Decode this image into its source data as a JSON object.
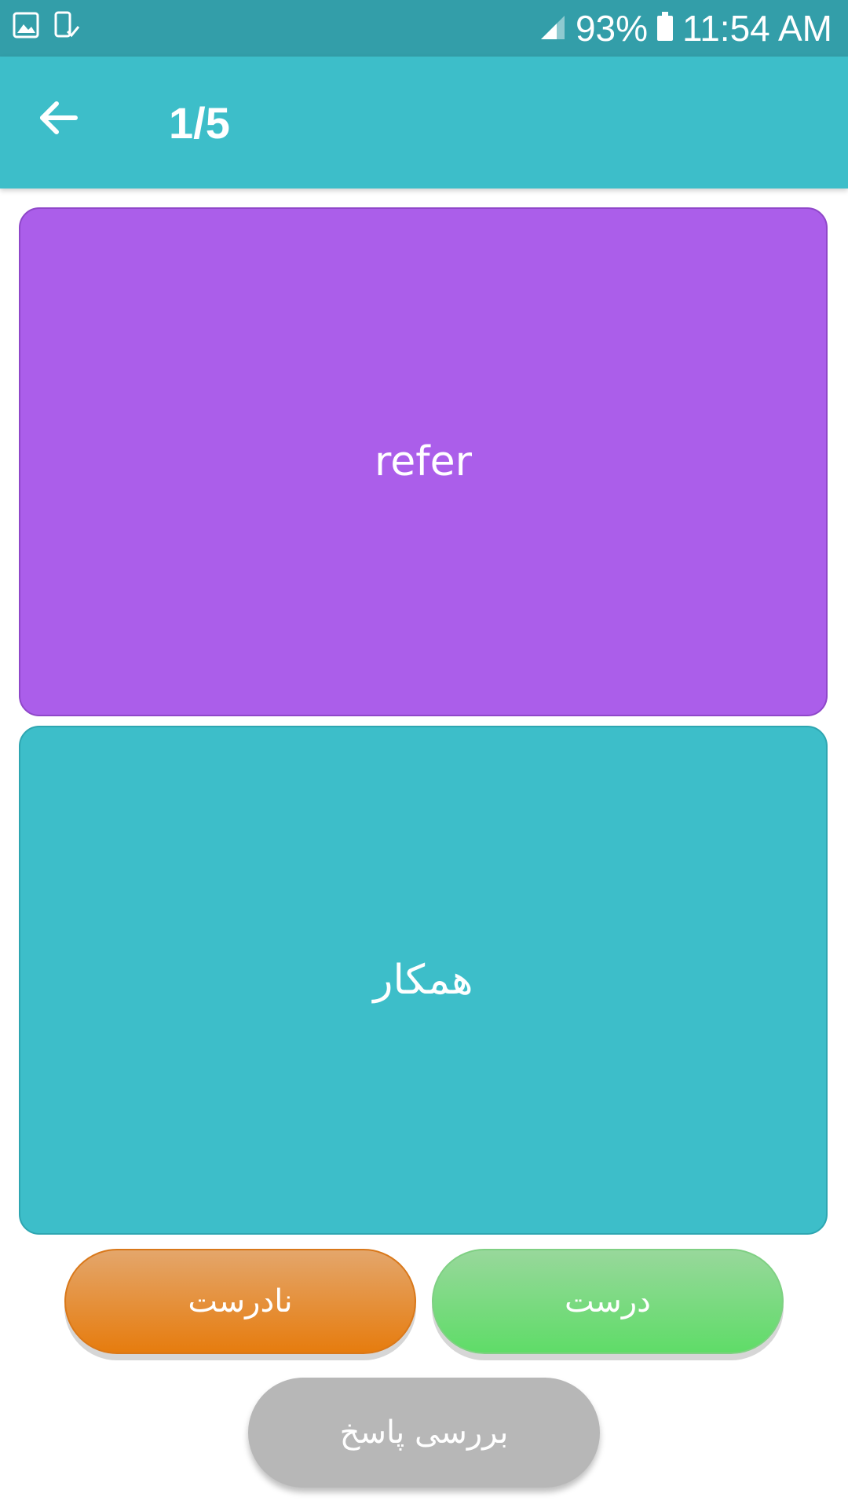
{
  "status_bar": {
    "battery": "93%",
    "time": "11:54 AM",
    "icons": [
      "gallery-icon",
      "device-check-icon",
      "signal-icon",
      "battery-icon"
    ]
  },
  "app_bar": {
    "title": "1/5",
    "back_icon": "arrow-left-icon"
  },
  "cards": {
    "word": "refer",
    "meaning": "همکار"
  },
  "buttons": {
    "wrong_label": "نادرست",
    "correct_label": "درست",
    "check_label": "بررسی پاسخ"
  },
  "colors": {
    "status_bar": "#339ea9",
    "app_bar": "#3dbec9",
    "word_card": "#ab5eea",
    "meaning_card": "#3dbec9",
    "wrong_button": "#e67c0e",
    "correct_button": "#5fdc68",
    "check_button": "#b7b7b7"
  }
}
